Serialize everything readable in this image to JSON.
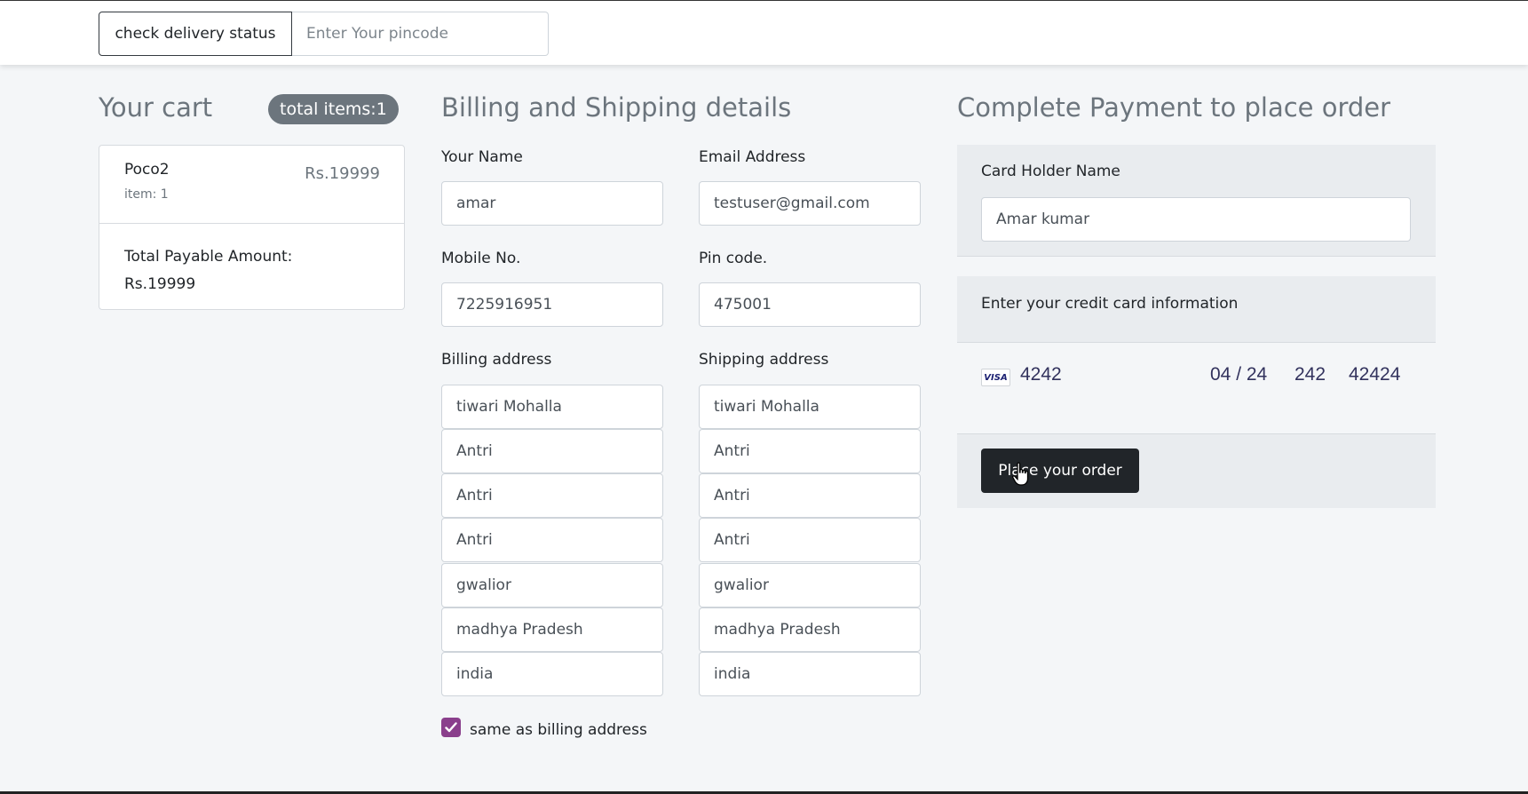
{
  "header": {
    "delivery_button": "check delivery status",
    "pincode_placeholder": "Enter Your pincode"
  },
  "cart": {
    "heading": "Your cart",
    "badge": "total items:1",
    "item": {
      "name": "Poco2",
      "qty": "item: 1",
      "price": "Rs.19999"
    },
    "total_label": "Total Payable Amount:",
    "total_value": "Rs.19999"
  },
  "billing": {
    "heading": "Billing and Shipping details",
    "name_label": "Your Name",
    "name_value": "amar",
    "email_label": "Email Address",
    "email_value": "testuser@gmail.com",
    "mobile_label": "Mobile No.",
    "mobile_value": "7225916951",
    "pin_label": "Pin code.",
    "pin_value": "475001",
    "billing_label": "Billing address",
    "shipping_label": "Shipping address",
    "billing_lines": [
      "tiwari Mohalla",
      "Antri",
      "Antri",
      "Antri",
      "gwalior",
      "madhya Pradesh",
      "india"
    ],
    "shipping_lines": [
      "tiwari Mohalla",
      "Antri",
      "Antri",
      "Antri",
      "gwalior",
      "madhya Pradesh",
      "india"
    ],
    "same_as_billing_label": "same as billing address",
    "same_as_billing_checked": true,
    "checkbox_color": "#8a3f8c"
  },
  "payment": {
    "heading": "Complete Payment to place order",
    "card_holder_label": "Card Holder Name",
    "card_holder_value": "Amar kumar",
    "card_info_label": "Enter your credit card information",
    "card_brand": "VISA",
    "card_number": "4242",
    "card_expiry": "04 / 24",
    "card_cvc": "242",
    "card_zip": "42424",
    "submit_label": "Place your order"
  }
}
